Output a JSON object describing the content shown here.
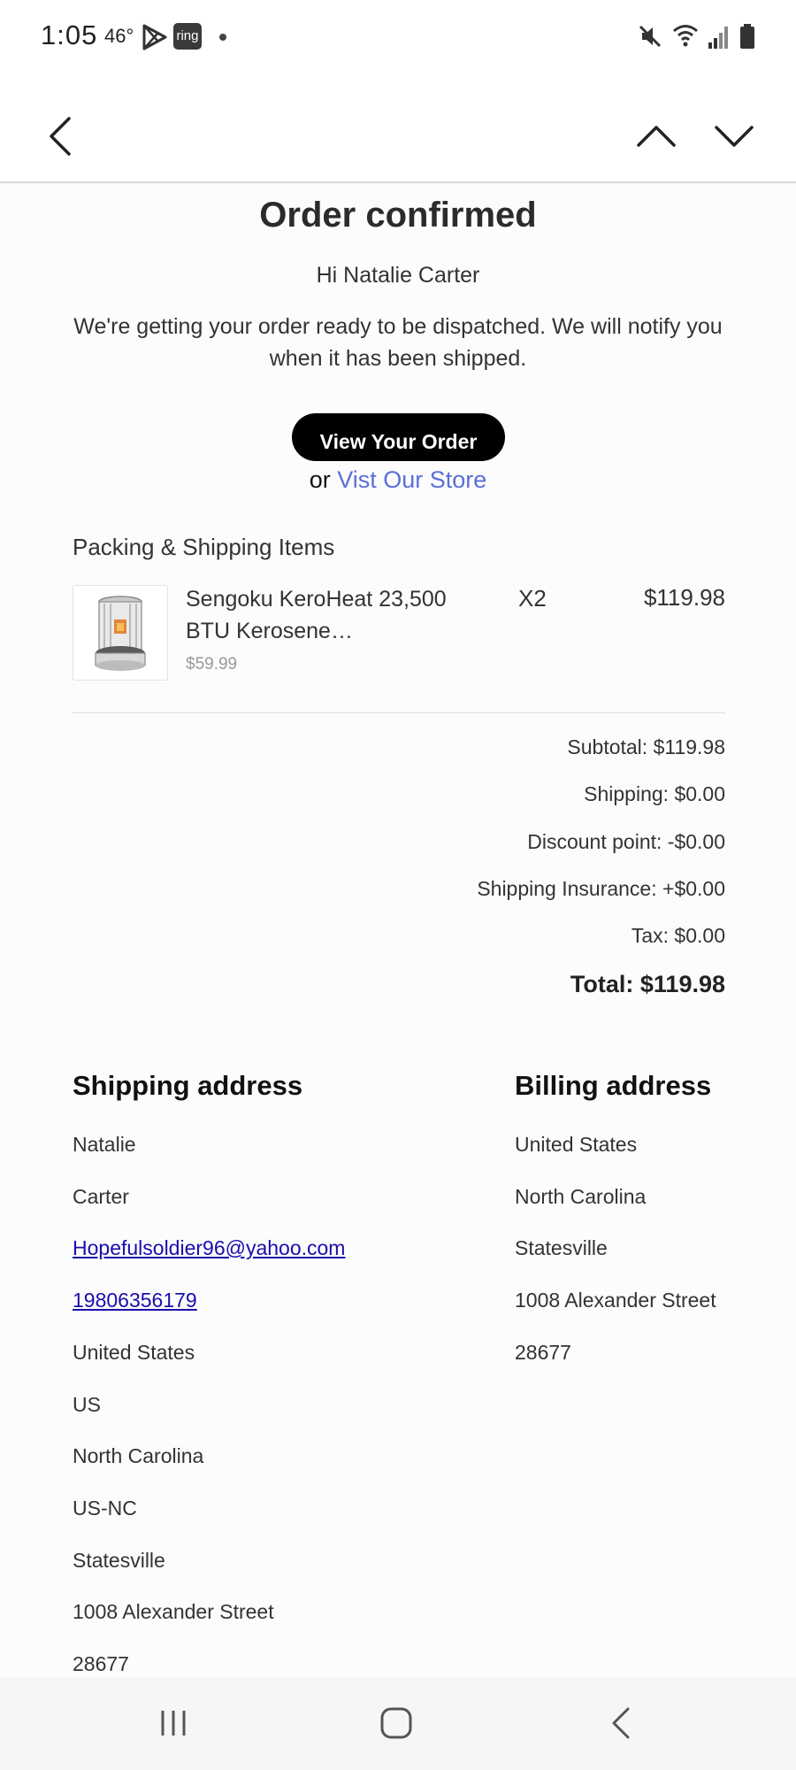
{
  "status_bar": {
    "time": "1:05",
    "temperature": "46°",
    "notification_icons": [
      "play-store-icon",
      "ring-icon"
    ],
    "ring_label": "ring",
    "system_icons": [
      "mute-icon",
      "wifi-icon",
      "signal-icon",
      "battery-icon"
    ]
  },
  "toolbar": {
    "icons": [
      "back-arrow-icon",
      "chevron-up-icon",
      "chevron-down-icon"
    ]
  },
  "email": {
    "title": "Order confirmed",
    "greeting": "Hi Natalie Carter",
    "message": "We're getting your order ready to be dispatched. We will notify you when it has been shipped.",
    "view_order_button": "View Your Order",
    "or_text": "or ",
    "store_link": "Vist Our Store",
    "items_title": "Packing & Shipping Items",
    "items": [
      {
        "name": "Sengoku KeroHeat 23,500 BTU Kerosene…",
        "unit_price": "$59.99",
        "quantity": "X2",
        "total": "$119.98",
        "thumbnail": "kerosene-heater-image"
      }
    ],
    "summary": {
      "subtotal": "Subtotal: $119.98",
      "shipping": "Shipping: $0.00",
      "discount": "Discount point: -$0.00",
      "insurance": "Shipping Insurance: +$0.00",
      "tax": "Tax: $0.00",
      "total": "Total: $119.98"
    },
    "shipping_address": {
      "heading": "Shipping address",
      "first_name": "Natalie",
      "last_name": "Carter",
      "email": "Hopefulsoldier96@yahoo.com",
      "phone": "19806356179",
      "country": "United States",
      "country_code": "US",
      "state": "North Carolina",
      "state_code": "US-NC",
      "city": "Statesville",
      "street": "1008 Alexander Street",
      "zip": "28677"
    },
    "billing_address": {
      "heading": "Billing address",
      "country": "United States",
      "state": "North Carolina",
      "city": "Statesville",
      "street": "1008 Alexander Street",
      "zip": "28677"
    }
  },
  "nav_bar": {
    "icons": [
      "recent-apps-icon",
      "home-icon",
      "back-icon"
    ]
  },
  "colors": {
    "link_blue": "#5b6fd6",
    "email_link": "#1a0dab",
    "button_black": "#000000",
    "muted_gray": "#999999"
  }
}
